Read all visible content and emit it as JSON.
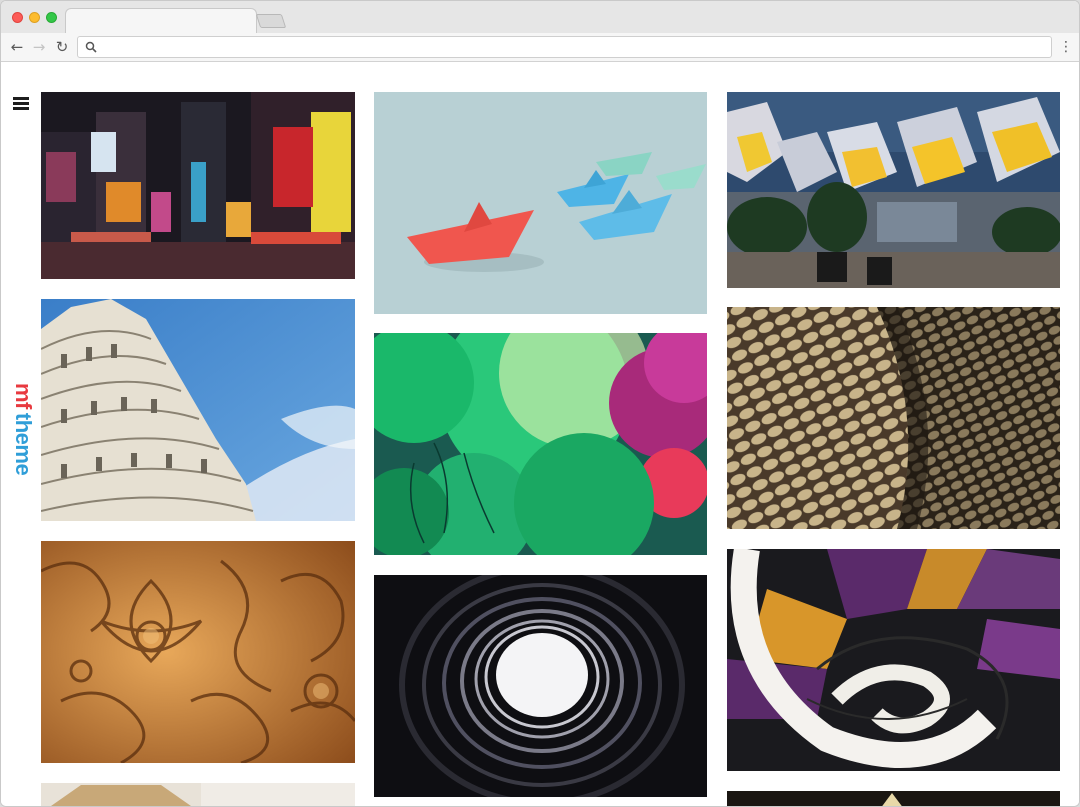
{
  "browser": {
    "tab_title": "",
    "address_value": "",
    "address_placeholder": ""
  },
  "site": {
    "logo_mark": "mf",
    "logo_word": "theme",
    "logo_colors": {
      "mark": "#e8393f",
      "word": "#2f9ed8"
    }
  },
  "gallery": {
    "columns": [
      {
        "tiles": [
          "city-night-billboards",
          "leaning-tower-pisa",
          "carved-wood-ornament",
          "building-partial"
        ]
      },
      {
        "tiles": [
          "paper-boats",
          "green-balloons",
          "spiral-tunnel"
        ]
      },
      {
        "tiles": [
          "cube-houses",
          "woven-texture",
          "spiral-staircase",
          "dark-tile-partial"
        ]
      }
    ]
  },
  "icons": [
    "menu-icon",
    "back-arrow-icon",
    "forward-arrow-icon",
    "reload-icon",
    "search-icon",
    "kebab-menu-icon"
  ]
}
